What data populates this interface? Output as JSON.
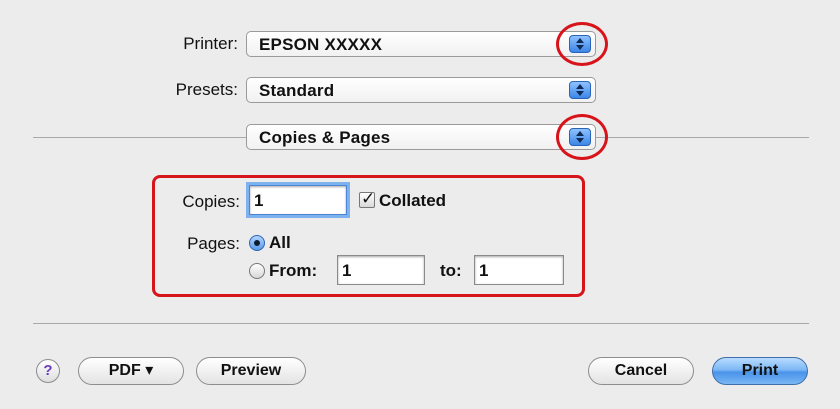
{
  "printer": {
    "label": "Printer:",
    "value": "EPSON XXXXX"
  },
  "presets": {
    "label": "Presets:",
    "value": "Standard"
  },
  "section_menu": {
    "value": "Copies & Pages"
  },
  "copies": {
    "label": "Copies:",
    "value": "1",
    "collated_label": "Collated",
    "collated_checked": true
  },
  "pages": {
    "label": "Pages:",
    "all_label": "All",
    "from_label": "From:",
    "from_value": "1",
    "to_label": "to:",
    "to_value": "1",
    "selected": "All"
  },
  "buttons": {
    "help_glyph": "?",
    "pdf_label": "PDF ▾",
    "preview_label": "Preview",
    "cancel_label": "Cancel",
    "print_label": "Print"
  },
  "colors": {
    "annotation_red": "#d8141b",
    "default_button_blue": "#4a93ea"
  }
}
